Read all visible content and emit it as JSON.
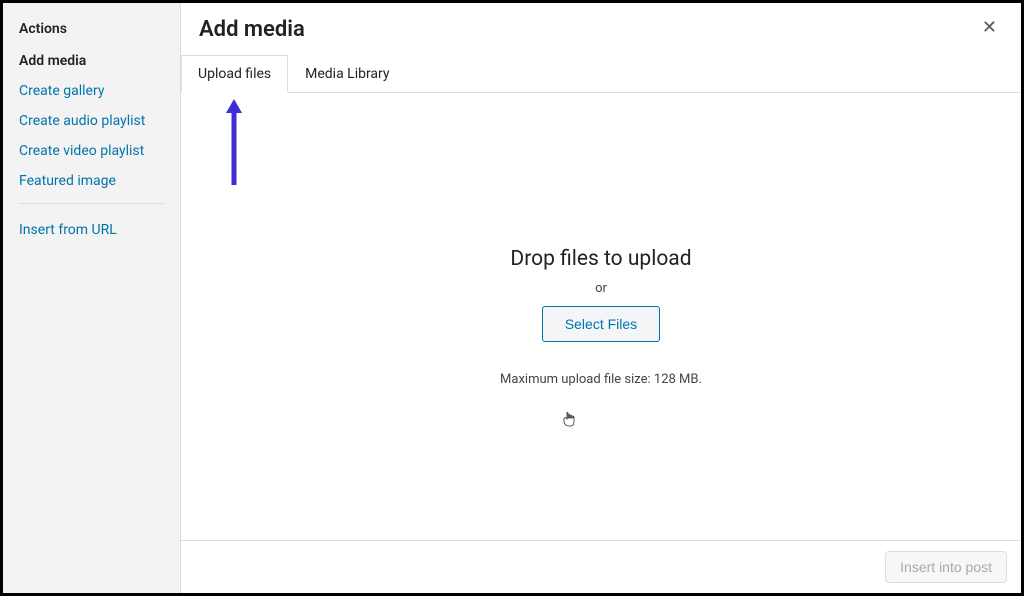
{
  "sidebar": {
    "heading": "Actions",
    "items": [
      {
        "label": "Add media",
        "active": true
      },
      {
        "label": "Create gallery"
      },
      {
        "label": "Create audio playlist"
      },
      {
        "label": "Create video playlist"
      },
      {
        "label": "Featured image"
      }
    ],
    "insert_url": "Insert from URL"
  },
  "modal": {
    "title": "Add media",
    "tabs": [
      {
        "label": "Upload files",
        "active": true
      },
      {
        "label": "Media Library"
      }
    ]
  },
  "uploader": {
    "drop_title": "Drop files to upload",
    "or": "or",
    "select_btn": "Select Files",
    "max_note": "Maximum upload file size: 128 MB."
  },
  "footer": {
    "insert_btn": "Insert into post"
  }
}
